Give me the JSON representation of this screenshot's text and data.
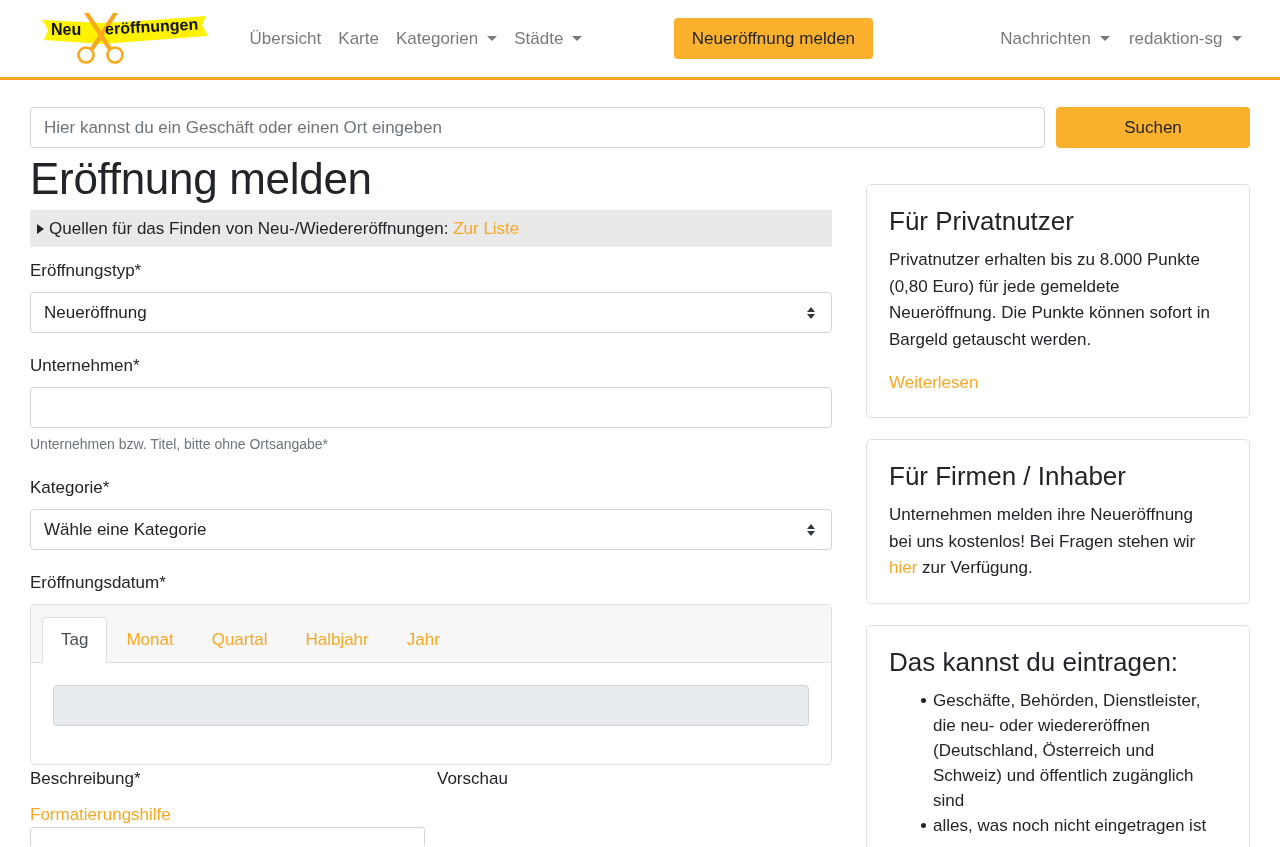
{
  "navbar": {
    "logo": {
      "word_1": "Neu",
      "word_2": "eröffnungen"
    },
    "links": [
      {
        "label": "Übersicht",
        "dropdown": false
      },
      {
        "label": "Karte",
        "dropdown": false
      },
      {
        "label": "Kategorien",
        "dropdown": true
      },
      {
        "label": "Städte",
        "dropdown": true
      }
    ],
    "cta_button": "Neueröffnung melden",
    "right_links": [
      {
        "label": "Nachrichten",
        "dropdown": true
      },
      {
        "label": "redaktion-sg",
        "dropdown": true
      }
    ]
  },
  "search": {
    "placeholder": "Hier kannst du ein Geschäft oder einen Ort eingeben",
    "button": "Suchen"
  },
  "form": {
    "title": "Eröffnung melden",
    "sources": {
      "text": "Quellen für das Finden von Neu-/Wiedereröffnungen:",
      "link": "Zur Liste",
      "expanded": false
    },
    "fields": [
      {
        "kind": "select",
        "label": "Eröffnungstyp*",
        "value": "Neueröffnung"
      },
      {
        "kind": "text",
        "label": "Unternehmen*",
        "help": "Unternehmen bzw. Titel, bitte ohne Ortsangabe*"
      },
      {
        "kind": "select",
        "label": "Kategorie*",
        "value": "Wähle eine Kategorie"
      },
      {
        "kind": "date",
        "label": "Eröffnungsdatum*",
        "tabs": [
          {
            "label": "Tag",
            "selected": true
          },
          {
            "label": "Monat",
            "selected": false
          },
          {
            "label": "Quartal",
            "selected": false
          },
          {
            "label": "Halbjahr",
            "selected": false
          },
          {
            "label": "Jahr",
            "selected": false
          }
        ],
        "input": {
          "disabled": true
        }
      }
    ],
    "description": {
      "label": "Beschreibung*",
      "help_link": "Formatierungshilfe",
      "preview_label": "Vorschau"
    }
  },
  "sidebar": {
    "cards": [
      {
        "kind": "paragraph",
        "title": "Für Privatnutzer",
        "text_parts": [
          {
            "text": "Privatnutzer erhalten bis zu 8.000 Punkte (0,80 Euro) für jede gemeldete Neueröffnung. Die Punkte können sofort in Bargeld getauscht werden."
          }
        ],
        "link": "Weiterlesen"
      },
      {
        "kind": "paragraph",
        "title": "Für Firmen / Inhaber",
        "text_parts": [
          {
            "text": "Unternehmen melden ihre Neueröffnung bei uns kostenlos! Bei Fragen stehen wir "
          },
          {
            "link": "hier"
          },
          {
            "text": " zur Verfügung."
          }
        ]
      },
      {
        "kind": "list",
        "title": "Das kannst du eintragen:",
        "items": [
          "Geschäfte, Behörden, Dienstleister, die neu- oder wiedereröffnen (Deutschland, Österreich und Schweiz) und öffentlich zugänglich sind",
          "alles, was noch nicht eingetragen ist"
        ]
      }
    ]
  }
}
